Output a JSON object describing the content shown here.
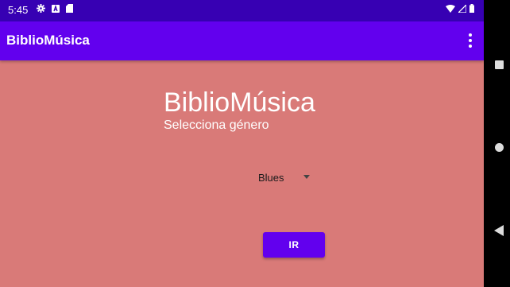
{
  "status_bar": {
    "time": "5:45",
    "left_icons": [
      "gear-icon",
      "a-notification-icon",
      "sd-card-icon"
    ],
    "right_icons": [
      "wifi-icon",
      "signal-icon",
      "battery-icon"
    ]
  },
  "app_bar": {
    "title": "BiblioMúsica",
    "menu_icon": "more-vertical-icon"
  },
  "main": {
    "heading": "BiblioMúsica",
    "subheading": "Selecciona género",
    "genre_spinner": {
      "selected": "Blues"
    },
    "go_button_label": "IR"
  },
  "nav_bar": {
    "buttons": [
      "recents-icon",
      "home-icon",
      "back-icon"
    ]
  },
  "colors": {
    "status_bar": "#3700b3",
    "app_bar": "#6200ee",
    "background": "#d97a78",
    "button": "#6200ee"
  }
}
